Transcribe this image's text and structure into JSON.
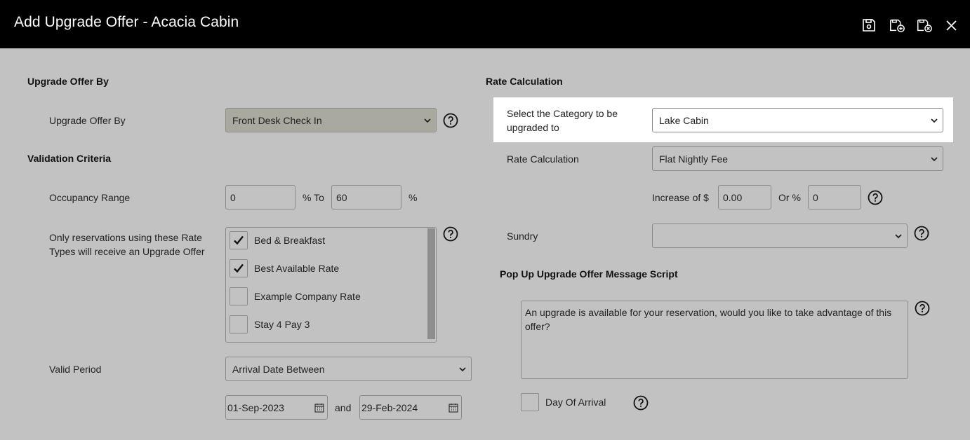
{
  "window": {
    "title": "Add Upgrade Offer - Acacia Cabin",
    "icons": [
      "save-icon",
      "save-and-add-icon",
      "save-and-close-icon",
      "close-icon"
    ]
  },
  "left": {
    "upgrade_offer_by_heading": "Upgrade Offer By",
    "upgrade_offer_by_label": "Upgrade Offer By",
    "upgrade_offer_by_value": "Front Desk Check In",
    "validation_heading": "Validation Criteria",
    "occupancy_label": "Occupancy Range",
    "occupancy_from": "0",
    "occupancy_to_label": "% To",
    "occupancy_to": "60",
    "occupancy_pct": "%",
    "rate_types_label": "Only reservations using these Rate Types will receive an Upgrade Offer",
    "rate_types": [
      {
        "label": "Bed & Breakfast",
        "checked": true
      },
      {
        "label": "Best Available Rate",
        "checked": true
      },
      {
        "label": "Example Company Rate",
        "checked": false
      },
      {
        "label": "Stay 4 Pay 3",
        "checked": false
      }
    ],
    "valid_period_label": "Valid Period",
    "valid_period_value": "Arrival Date Between",
    "date_from": "01-Sep-2023",
    "date_and": "and",
    "date_to": "29-Feb-2024"
  },
  "right": {
    "rate_calc_heading": "Rate Calculation",
    "category_label": "Select the Category to be upgraded to",
    "category_value": "Lake Cabin",
    "rate_calc_label": "Rate Calculation",
    "rate_calc_value": "Flat Nightly Fee",
    "increase_label": "Increase of $",
    "increase_value": "0.00",
    "or_pct_label": "Or %",
    "or_pct_value": "0",
    "sundry_label": "Sundry",
    "sundry_value": "",
    "popup_heading": "Pop Up Upgrade Offer Message Script",
    "popup_message": "An upgrade is available for your reservation, would you like to take advantage of this offer?",
    "day_of_arrival_label": "Day Of Arrival",
    "day_of_arrival_checked": false
  },
  "colors": {
    "titlebar": "#000000",
    "background": "#c2c2c2",
    "highlight": "#ffffff"
  }
}
